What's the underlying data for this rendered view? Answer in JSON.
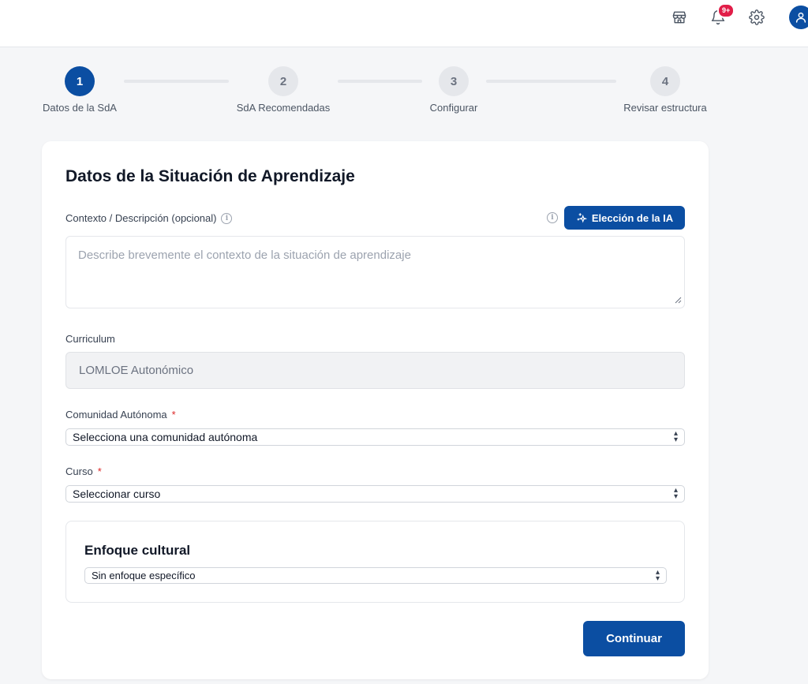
{
  "header": {
    "notification_badge": "9+",
    "icons": [
      "store-icon",
      "bell-icon",
      "gear-icon",
      "user-icon"
    ]
  },
  "stepper": {
    "steps": [
      {
        "number": "1",
        "label": "Datos de la SdA",
        "active": true
      },
      {
        "number": "2",
        "label": "SdA Recomendadas",
        "active": false
      },
      {
        "number": "3",
        "label": "Configurar",
        "active": false
      },
      {
        "number": "4",
        "label": "Revisar estructura",
        "active": false
      }
    ]
  },
  "form": {
    "title": "Datos de la Situación de Aprendizaje",
    "context": {
      "label": "Contexto / Descripción (opcional)",
      "placeholder": "Describe brevemente el contexto de la situación de aprendizaje",
      "value": ""
    },
    "ai_button_label": "Elección de la IA",
    "curriculum": {
      "label": "Curriculum",
      "value": "LOMLOE Autonómico"
    },
    "comunidad": {
      "label": "Comunidad Autónoma",
      "required_mark": "*",
      "selected": "Selecciona una comunidad autónoma"
    },
    "curso": {
      "label": "Curso",
      "required_mark": "*",
      "selected": "Seleccionar curso"
    },
    "enfoque": {
      "title": "Enfoque cultural",
      "selected": "Sin enfoque específico"
    },
    "continue_label": "Continuar"
  },
  "colors": {
    "primary": "#0b4ea2",
    "badge": "#e11d48",
    "required": "#dc2626"
  }
}
